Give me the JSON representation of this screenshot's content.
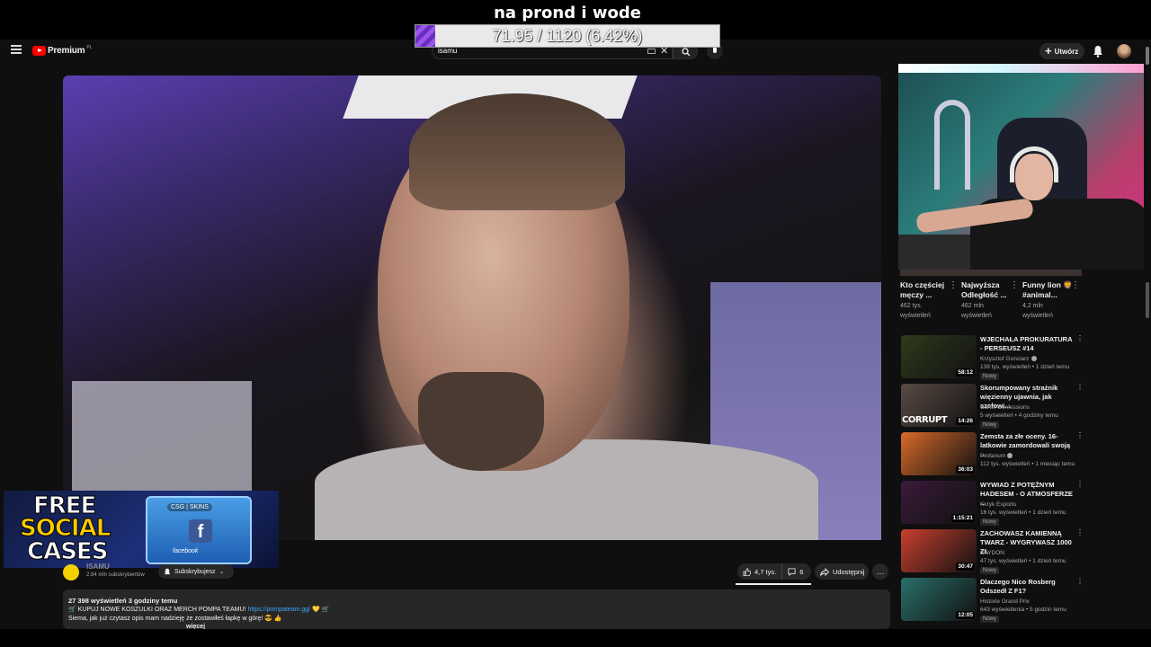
{
  "overlay": {
    "goal_title": "na prond i wode",
    "goal_text": "71.95 / 1120 (6.42%)",
    "goal_fraction": 0.0642,
    "goal_color": "#8a45e0"
  },
  "header": {
    "brand": "Premium",
    "region": "PL",
    "search_value": "isamu",
    "create_label": "Utwórz",
    "icons": [
      "menu-icon",
      "youtube-logo",
      "keyboard-icon",
      "close-icon",
      "search-icon",
      "mic-icon",
      "plus-icon",
      "bell-icon",
      "avatar"
    ]
  },
  "ad": {
    "line1": "FREE",
    "line2": "SOCIAL",
    "line3": "CASES",
    "tag": "CSG | SKINS",
    "fb_letter": "f",
    "fb_label": "facebook"
  },
  "channel": {
    "name": "ISAMU",
    "subscribers": "2,84 mln subskrybentów",
    "subscribe_label": "Subskrybujesz"
  },
  "actions": {
    "likes": "4,7 tys.",
    "comments": "6",
    "share_label": "Udostępnij",
    "more": "…"
  },
  "description": {
    "stats": "27 398 wyświetleń  3 godziny temu",
    "line1": "🛒 KUPUJ NOWE KOSZULKI ORAZ MERCH POMPA TEAMU!",
    "line1_link": "https://pompateam.gg/",
    "line1_tail": " 💛 🛒",
    "line2": "Siema, jak już czytasz opis mam nadzieję że zostawiłeś łapkę w górę! 😎 👍",
    "more_label": "więcej"
  },
  "shorts": [
    {
      "title": "Kto częściej męczy ...",
      "views": "462 tys.",
      "suffix": "wyświetleń"
    },
    {
      "title": "Najwyższa Odległość ...",
      "views": "462 mln",
      "suffix": "wyświetleń"
    },
    {
      "title": "Funny lion 🦁 #animal...",
      "views": "4,2 mln",
      "suffix": "wyświetleń"
    }
  ],
  "recommendations": [
    {
      "title": "WJECHAŁA PROKURATURA - PERSEUSZ #14",
      "channel": "Krzysztof Gonciarz",
      "verified": true,
      "stats": "139 tys. wyświetleń • 1 dzień temu",
      "badge": "Nowy",
      "duration": "58:12",
      "thumb_color": "#2f3a1c"
    },
    {
      "title": "Skorumpowany strażnik więzienny ujawnia, jak szefowi...",
      "channel": "Cartel Confessions",
      "verified": false,
      "stats": "5 wyświetleń • 4 godziny temu",
      "badge": "Nowy",
      "duration": "14:26",
      "thumb_color": "#5a4a45",
      "thumb_caption": "CORRUPT"
    },
    {
      "title": "Zemsta za złe oceny. 16-latkowie zamordowali swoją ...",
      "channel": "Profanum",
      "verified": true,
      "stats": "112 tys. wyświetleń • 1 miesiąc temu",
      "badge": "",
      "duration": "36:03",
      "thumb_color": "#d96a2a"
    },
    {
      "title": "WYWIAD Z POTĘŻNYM HADESEM - O ATMOSFERZE ...",
      "channel": "Krzyk Esportu",
      "verified": false,
      "stats": "16 tys. wyświetleń • 1 dzień temu",
      "badge": "Nowy",
      "duration": "1:15:21",
      "thumb_color": "#3a1a3a"
    },
    {
      "title": "ZACHOWASZ KAMIENNĄ TWARZ - WYGRYWASZ 1000 ZŁ",
      "channel": "SAYDON",
      "verified": false,
      "stats": "47 tys. wyświetleń • 1 dzień temu",
      "badge": "Nowy",
      "duration": "30:47",
      "thumb_color": "#c9402f"
    },
    {
      "title": "Dlaczego Nico Rosberg Odszedł Z F1?",
      "channel": "Historie Grand Prix",
      "verified": false,
      "stats": "643 wyświetlenia • 5 godzin temu",
      "badge": "Nowy",
      "duration": "12:05",
      "thumb_color": "#2a6f6a"
    }
  ]
}
